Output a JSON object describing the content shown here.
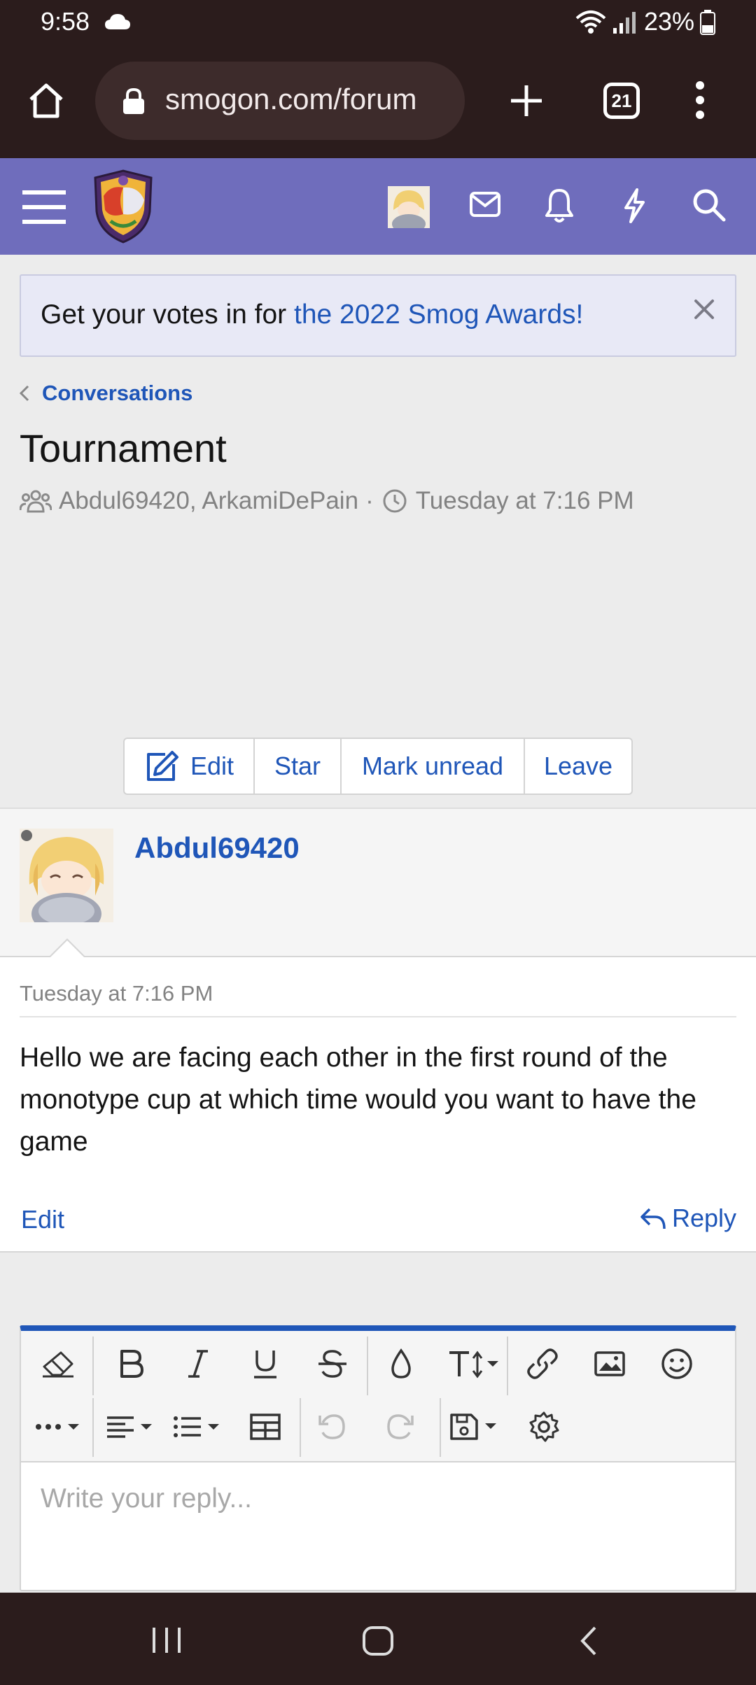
{
  "status_bar": {
    "time": "9:58",
    "battery": "23%",
    "icons": [
      "cloud-icon",
      "wifi-icon",
      "signal-icon",
      "battery-icon"
    ]
  },
  "browser": {
    "url": "smogon.com/forum",
    "tab_count": "21",
    "icons": [
      "home-icon",
      "lock-icon",
      "plus-icon",
      "more-vert-icon"
    ]
  },
  "site_header": {
    "icons": [
      "hamburger-icon",
      "smogon-logo",
      "mail-icon",
      "bell-icon",
      "bolt-icon",
      "search-icon"
    ],
    "brand_color": "#6f6dbc"
  },
  "notice": {
    "prefix": "Get your votes in for ",
    "link_text": "the 2022 Smog Awards!"
  },
  "breadcrumb": {
    "label": "Conversations"
  },
  "conversation": {
    "title": "Tournament",
    "participants": "Abdul69420, ArkamiDePain",
    "separator": "·",
    "started": "Tuesday at 7:16 PM"
  },
  "actions": {
    "edit": "Edit",
    "star": "Star",
    "mark_unread": "Mark unread",
    "leave": "Leave"
  },
  "message": {
    "author": "Abdul69420",
    "date": "Tuesday at 7:16 PM",
    "body": "Hello we are facing each other in the first round of the monotype cup at which time would you want to have the game",
    "edit_label": "Edit",
    "reply_label": "Reply"
  },
  "editor": {
    "placeholder": "Write your reply...",
    "toolbar_icons": [
      "eraser-icon",
      "bold-icon",
      "italic-icon",
      "underline-icon",
      "strikethrough-icon",
      "color-drop-icon",
      "text-size-icon",
      "link-icon",
      "image-icon",
      "smiley-icon",
      "more-icon",
      "align-icon",
      "list-icon",
      "table-icon",
      "undo-icon",
      "redo-icon",
      "save-draft-icon",
      "settings-icon"
    ]
  },
  "colors": {
    "link": "#1f56b8",
    "system_bar": "#2b1c1c",
    "accent_editor": "#1f56b8"
  }
}
